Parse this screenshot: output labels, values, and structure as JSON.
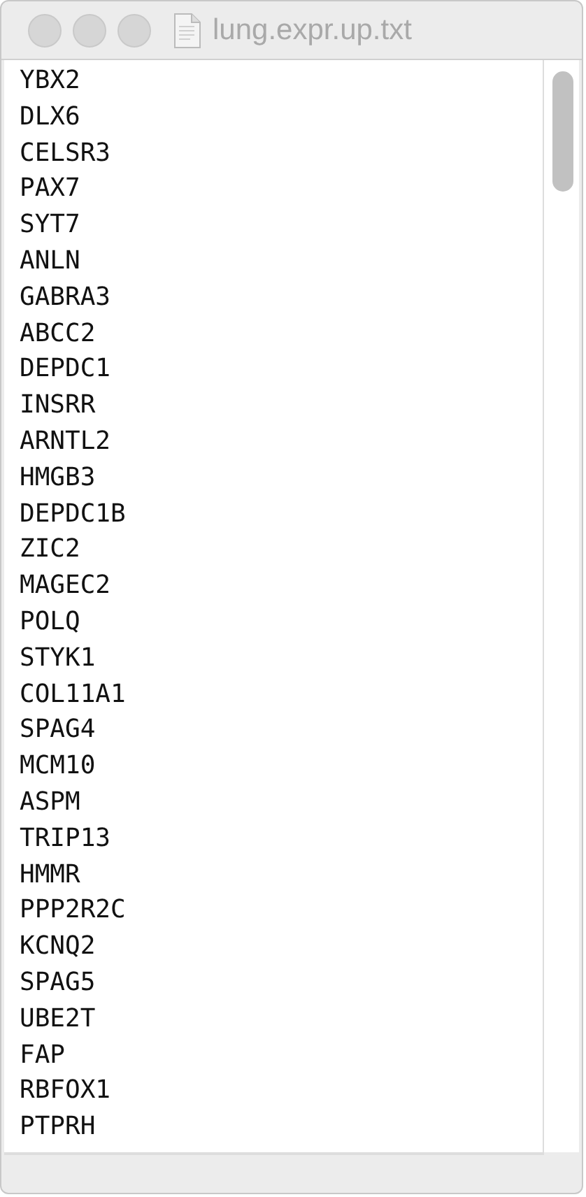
{
  "window": {
    "title": "lung.expr.up.txt"
  },
  "lines": [
    "YBX2",
    "DLX6",
    "CELSR3",
    "PAX7",
    "SYT7",
    "ANLN",
    "GABRA3",
    "ABCC2",
    "DEPDC1",
    "INSRR",
    "ARNTL2",
    "HMGB3",
    "DEPDC1B",
    "ZIC2",
    "MAGEC2",
    "POLQ",
    "STYK1",
    "COL11A1",
    "SPAG4",
    "MCM10",
    "ASPM",
    "TRIP13",
    "HMMR",
    "PPP2R2C",
    "KCNQ2",
    "SPAG5",
    "UBE2T",
    "FAP",
    "RBFOX1",
    "PTPRH"
  ]
}
